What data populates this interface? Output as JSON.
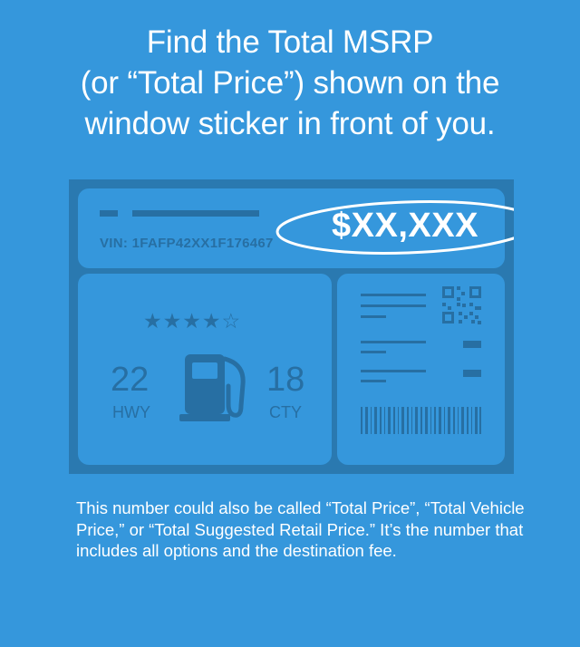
{
  "headline": {
    "line1": "Find the Total MSRP",
    "line2": "(or “Total Price”) shown on the",
    "line3": "window sticker in front of you."
  },
  "sticker": {
    "vin": "VIN: 1FAFP42XX1F176467",
    "price": "$XX,XXX",
    "stars": "★★★★☆",
    "highway_mpg": "22",
    "highway_label": "HWY",
    "city_mpg": "18",
    "city_label": "CTY",
    "icons": [
      "fuel-pump-icon",
      "qr-code-icon",
      "barcode-icon"
    ],
    "rating_stars": 4,
    "rating_max": 5
  },
  "note": "This number could also be called “Total Price”, “Total Vehicle Price,” or “Total Suggested Retail Price.” It’s the number that includes all options and the destination fee.",
  "colors": {
    "background": "#3597dc",
    "sticker_frame": "#2a79b0",
    "sticker_panel": "#3597dc",
    "sticker_ink": "#276fa3",
    "text": "#ffffff"
  }
}
